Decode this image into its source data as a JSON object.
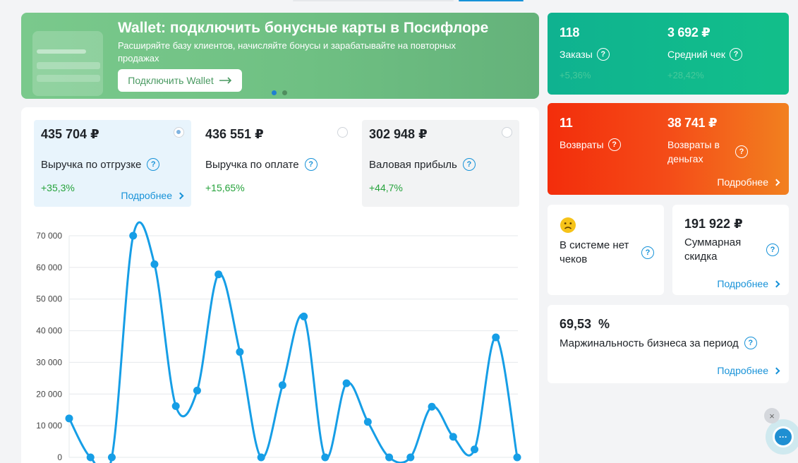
{
  "colors": {
    "accent": "#1792d8",
    "positive": "#26a33c",
    "series": "#169ee6",
    "green_kpi": "#12bb8c",
    "red_kpi": "#f3411a"
  },
  "banner": {
    "title": "Wallet: подключить бонусные карты в Посифлоре",
    "text": "Расширяйте базу клиентов, начисляйте бонусы и зарабатывайте на повторных продажах",
    "button_label": "Подключить Wallet",
    "button_icon": "arrow-right-icon",
    "slide_count": 2,
    "active_slide": 1
  },
  "kpi_orders": {
    "orders": {
      "value": "118",
      "label": "Заказы",
      "delta": "+5,36%"
    },
    "avg_check": {
      "value": "3 692 ₽",
      "label": "Средний чек",
      "delta": "+28,42%"
    }
  },
  "kpi_returns": {
    "returns": {
      "value": "11",
      "label": "Возвраты"
    },
    "returns_money": {
      "value": "38 741 ₽",
      "label": "Возвраты в деньгах"
    },
    "more": "Подробнее"
  },
  "tiles": [
    {
      "value": "435 704 ₽",
      "label": "Выручка по отгрузке",
      "delta": "+35,3%",
      "more": "Подробнее",
      "selected": true
    },
    {
      "value": "436 551 ₽",
      "label": "Выручка по оплате",
      "delta": "+15,65%",
      "selected": false
    },
    {
      "value": "302 948 ₽",
      "label": "Валовая прибыль",
      "delta": "+44,7%",
      "selected": false
    }
  ],
  "no_checks": {
    "icon": "sad-face-icon",
    "label": "В системе нет чеков"
  },
  "discount": {
    "value": "191 922 ₽",
    "label": "Суммарная скидка",
    "more": "Подробнее"
  },
  "margin": {
    "value": "69,53  %",
    "label": "Маржинальность бизнеса за период",
    "more": "Подробнее"
  },
  "chat": {
    "close": "×",
    "icon": "chat-bubble-icon"
  },
  "chart_data": {
    "type": "line",
    "yticks": [
      "0",
      "10 000",
      "20 000",
      "30 000",
      "40 000",
      "50 000",
      "60 000",
      "70 000"
    ],
    "ylim": [
      0,
      70000
    ],
    "grid": true,
    "series": [
      {
        "values": [
          12300,
          0,
          0,
          70000,
          61000,
          16200,
          21100,
          57800,
          33300,
          0,
          22800,
          44500,
          0,
          23400,
          11200,
          0,
          0,
          16000,
          6500,
          2500,
          37900,
          0
        ]
      }
    ]
  }
}
